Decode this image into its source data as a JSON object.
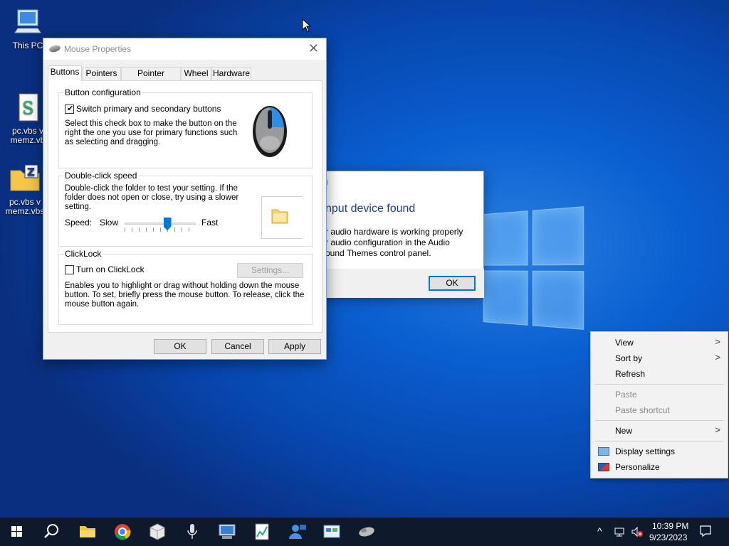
{
  "desktop": {
    "icons": [
      {
        "label": "This PC"
      },
      {
        "label": "pc.vbs v\nmemz.vb"
      },
      {
        "label": "pc.vbs v\nmemz.vbs"
      }
    ]
  },
  "audio_dialog": {
    "title_fragment": "h",
    "heading": "nput device found",
    "body": "r audio hardware is working properly\nr audio configuration in the Audio\nound Themes control panel.",
    "ok_label": "OK"
  },
  "mouse_properties": {
    "title": "Mouse Properties",
    "tabs": [
      "Buttons",
      "Pointers",
      "Pointer Options",
      "Wheel",
      "Hardware"
    ],
    "active_tab": "Buttons",
    "button_configuration": {
      "legend": "Button configuration",
      "checkbox_label": "Switch primary and secondary buttons",
      "checked": true,
      "description": "Select this check box to make the button on the\nright the one you use for primary functions such\nas selecting and dragging."
    },
    "double_click": {
      "legend": "Double-click speed",
      "description": "Double-click the folder to test your setting. If the\nfolder does not open or close, try using a slower\nsetting.",
      "speed_label": "Speed:",
      "slow_label": "Slow",
      "fast_label": "Fast",
      "speed_value": 0.6
    },
    "clicklock": {
      "legend": "ClickLock",
      "checkbox_label": "Turn on ClickLock",
      "checked": false,
      "settings_label": "Settings...",
      "description": "Enables you to highlight or drag without holding down the mouse\nbutton. To set, briefly press the mouse button. To release, click the\nmouse button again."
    },
    "buttons": {
      "ok": "OK",
      "cancel": "Cancel",
      "apply": "Apply"
    }
  },
  "context_menu": {
    "view": "View",
    "sort_by": "Sort by",
    "refresh": "Refresh",
    "paste": "Paste",
    "paste_shortcut": "Paste shortcut",
    "new": "New",
    "display_settings": "Display settings",
    "personalize": "Personalize"
  },
  "taskbar": {
    "apps": [
      "start-icon",
      "search-icon",
      "file-explorer-icon",
      "chrome-icon",
      "package-icon",
      "microphone-icon",
      "computer-management-icon",
      "notepad-chart-icon",
      "user-accounts-icon",
      "control-panel-icon",
      "mouse-icon"
    ],
    "time": "10:39 PM",
    "date": "9/23/2023"
  },
  "colors": {
    "accent": "#0078d7",
    "taskbar": "#0e1a2c",
    "menu_bg": "#f2f2f2"
  }
}
